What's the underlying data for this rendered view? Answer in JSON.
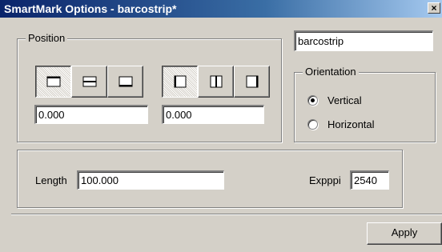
{
  "window": {
    "title": "SmartMark Options - barcostrip*",
    "close_glyph": "×"
  },
  "position": {
    "legend": "Position",
    "vertical_align_value": "0.000",
    "horizontal_align_value": "0.000",
    "vertical_align_buttons": [
      {
        "icon": "align-top-icon",
        "selected": true
      },
      {
        "icon": "align-middle-icon",
        "selected": false
      },
      {
        "icon": "align-bottom-icon",
        "selected": false
      }
    ],
    "horizontal_align_buttons": [
      {
        "icon": "align-left-icon",
        "selected": true
      },
      {
        "icon": "align-center-icon",
        "selected": false
      },
      {
        "icon": "align-right-icon",
        "selected": false
      }
    ]
  },
  "name_field": {
    "value": "barcostrip"
  },
  "orientation": {
    "legend": "Orientation",
    "options": [
      {
        "label": "Vertical",
        "selected": true
      },
      {
        "label": "Horizontal",
        "selected": false
      }
    ]
  },
  "params": {
    "length_label": "Length",
    "length_value": "100.000",
    "expppi_label": "Expppi",
    "expppi_value": "2540"
  },
  "footer": {
    "apply_label": "Apply"
  }
}
